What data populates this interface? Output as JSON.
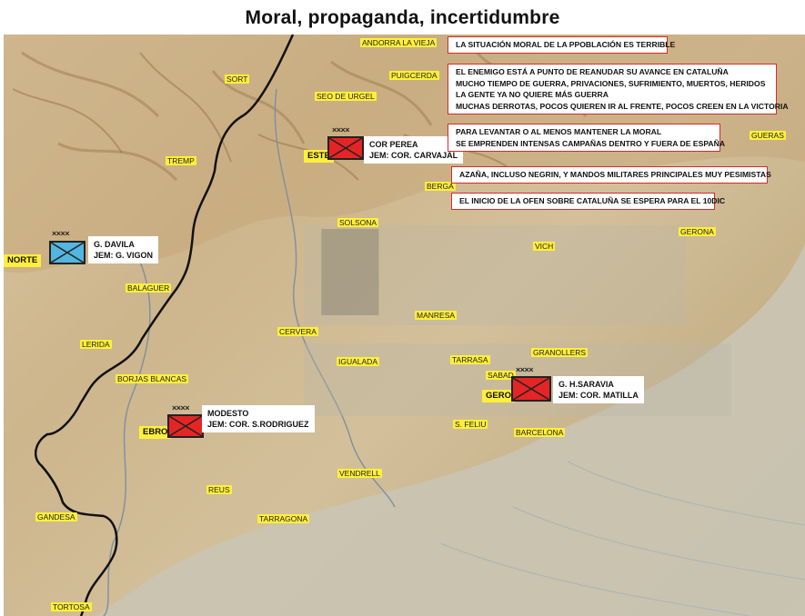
{
  "title": "Moral, propaganda, incertidumbre",
  "colors": {
    "nationalist_unit": "#53b6e0",
    "republican_unit": "#e52525",
    "place_label": "#ffef3a",
    "note_border": "#d62a2a",
    "front_line": "#111111"
  },
  "places": {
    "andorra": "ANDORRA LA VIEJA",
    "sort": "SORT",
    "puigcerda": "PUIGCERDA",
    "seo": "SEO DE URGEL",
    "gueras": "GUERAS",
    "tremp": "TREMP",
    "berga": "BERGA",
    "solsona": "SOLSONA",
    "gerona": "GERONA",
    "vich": "VICH",
    "balaguer": "BALAGUER",
    "manresa": "MANRESA",
    "cervera": "CERVERA",
    "lerida": "LERIDA",
    "granollers": "GRANOLLERS",
    "tarrasa": "TARRASA",
    "igualada": "IGUALADA",
    "sabadell": "SABAD",
    "borjas": "BORJAS BLANCAS",
    "sfeliu": "S. FELIU",
    "barcelona": "BARCELONA",
    "vendrell": "VENDRELL",
    "reus": "REUS",
    "gandesa": "GANDESA",
    "tarragona": "TARRAGONA",
    "tortosa": "TORTOSA"
  },
  "fronts": {
    "norte": "NORTE",
    "este": "ESTE",
    "gero": "GERO",
    "ebro": "EBRO"
  },
  "units": {
    "davila": {
      "echelon": "××××",
      "line1": "G. DAVILA",
      "line2": "JEM: G. VIGON",
      "side": "nationalist"
    },
    "perea": {
      "echelon": "××××",
      "line1": "COR PEREA",
      "line2": "JEM: COR. CARVAJAL",
      "side": "republican"
    },
    "saravia": {
      "echelon": "××××",
      "line1": "G. H.SARAVIA",
      "line2": "JEM: COR. MATILLA",
      "side": "republican"
    },
    "modesto": {
      "echelon": "××××",
      "line1": "MODESTO",
      "line2": "JEM: COR. S.RODRIGUEZ",
      "side": "republican"
    }
  },
  "notes": {
    "n1": "LA SITUACIÓN MORAL DE LA PPOBLACIÓN ES TERRIBLE",
    "n2": [
      "EL ENEMIGO ESTÁ A PUNTO DE REANUDAR SU AVANCE  EN CATALUÑA",
      "MUCHO TIEMPO DE GUERRA, PRIVACIONES, SUFRIMIENTO, MUERTOS, HERIDOS",
      "LA GENTE YA NO QUIERE MÁS GUERRA",
      "MUCHAS DERROTAS, POCOS QUIEREN IR AL FRENTE,  POCOS CREEN EN LA VICTORIA"
    ],
    "n3": [
      "PARA LEVANTAR O AL MENOS MANTENER LA MORAL",
      "SE EMPRENDEN INTENSAS CAMPAÑAS DENTRO Y FUERA DE ESPAÑA"
    ],
    "n4": "AZAÑA, INCLUSO NEGRIN, Y MANDOS MILITARES  PRINCIPALES MUY PESIMISTAS",
    "n5": "EL INICIO DE LA OFEN SOBRE CATALUÑA SE ESPERA PARA EL 10DIC"
  }
}
